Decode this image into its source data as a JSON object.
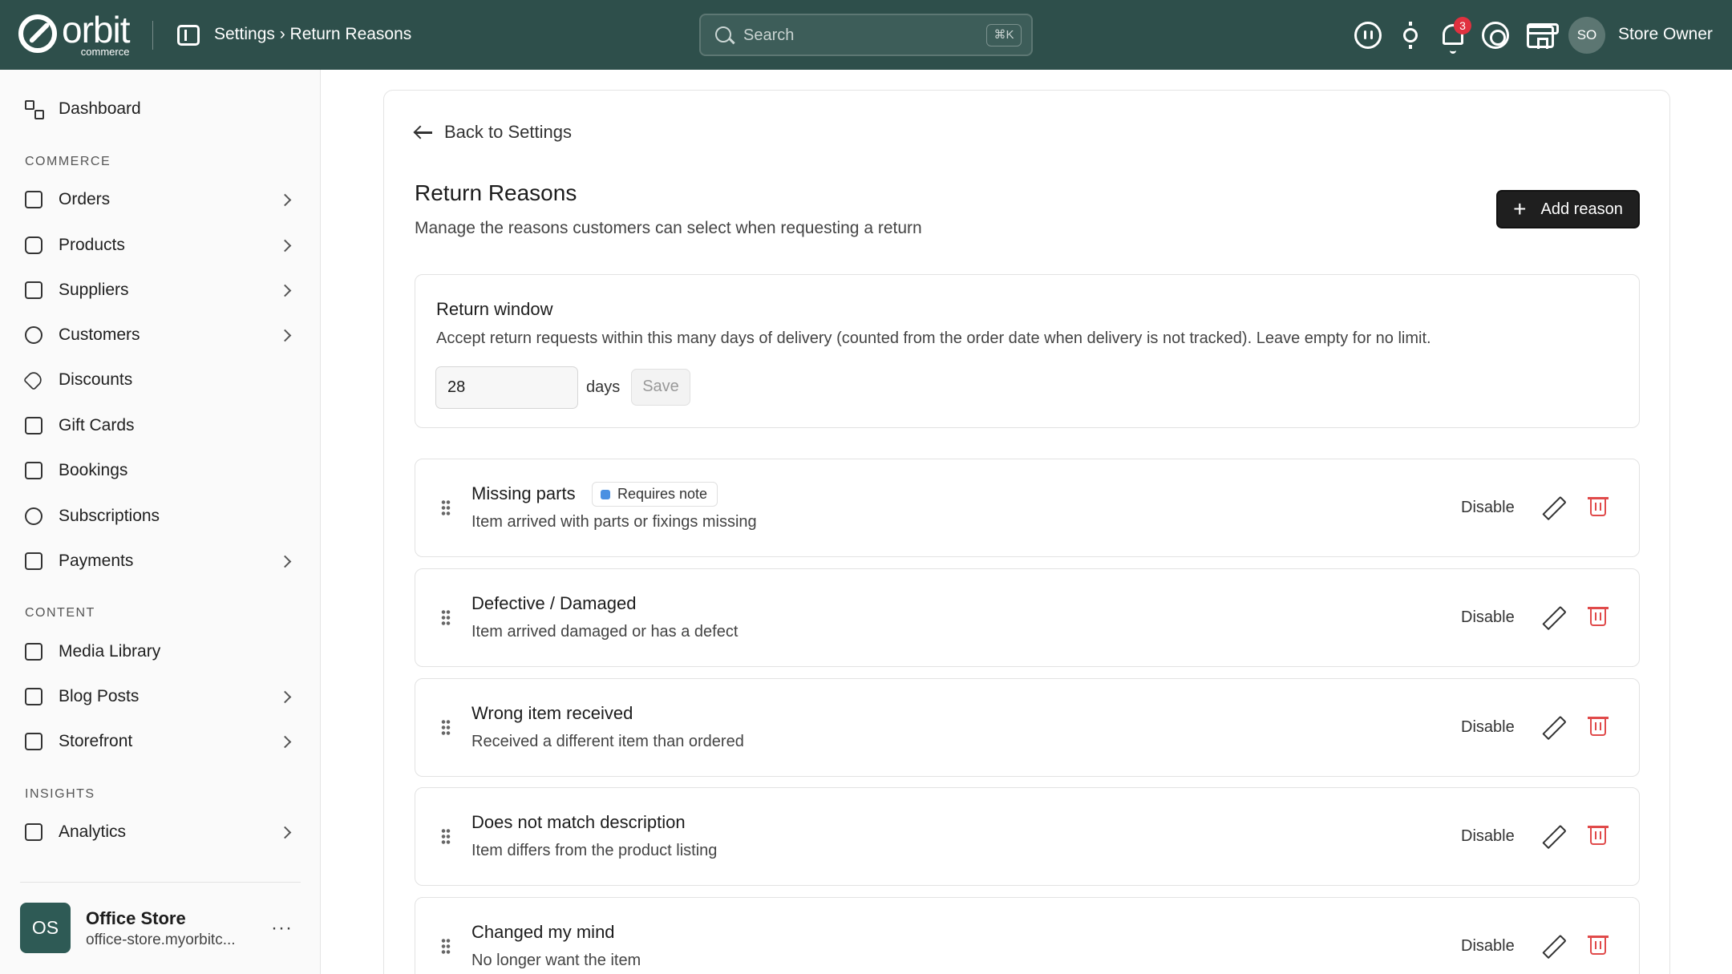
{
  "app": {
    "logo_word": "orbit",
    "logo_sub": "commerce",
    "breadcrumb": "Settings › Return Reasons"
  },
  "search": {
    "placeholder": "Search",
    "shortcut": "⌘K"
  },
  "topbar": {
    "notification_count": "3",
    "user_initials": "SO",
    "user_name": "Store Owner"
  },
  "sidebar": {
    "dashboard": "Dashboard",
    "sections": {
      "commerce": "COMMERCE",
      "content": "CONTENT",
      "insights": "INSIGHTS"
    },
    "items": {
      "orders": "Orders",
      "products": "Products",
      "suppliers": "Suppliers",
      "customers": "Customers",
      "discounts": "Discounts",
      "gift_cards": "Gift Cards",
      "bookings": "Bookings",
      "subscriptions": "Subscriptions",
      "payments": "Payments",
      "media_library": "Media Library",
      "blog_posts": "Blog Posts",
      "storefront": "Storefront",
      "analytics": "Analytics"
    },
    "store": {
      "initials": "OS",
      "name": "Office Store",
      "url": "office-store.myorbitc..."
    }
  },
  "main": {
    "back_label": "Back to Settings",
    "title": "Return Reasons",
    "subtitle": "Manage the reasons customers can select when requesting a return",
    "add_label": "Add reason",
    "return_window": {
      "title": "Return window",
      "description": "Accept return requests within this many days of delivery (counted from the order date when delivery is not tracked). Leave empty for no limit.",
      "value": "28",
      "unit": "days",
      "save_label": "Save"
    },
    "reasons": [
      {
        "title": "Missing parts",
        "badge": "Requires note",
        "description": "Item arrived with parts or fixings missing",
        "action": "Disable"
      },
      {
        "title": "Defective / Damaged",
        "description": "Item arrived damaged or has a defect",
        "action": "Disable"
      },
      {
        "title": "Wrong item received",
        "description": "Received a different item than ordered",
        "action": "Disable"
      },
      {
        "title": "Does not match description",
        "description": "Item differs from the product listing",
        "action": "Disable"
      },
      {
        "title": "Changed my mind",
        "description": "No longer want the item",
        "action": "Disable"
      }
    ]
  },
  "colors": {
    "topbar_bg": "#2e4f4b",
    "badge_red": "#e0313f",
    "delete_red": "#e04a4a",
    "note_blue": "#4a90e2",
    "primary_button": "#1f1f1f"
  }
}
